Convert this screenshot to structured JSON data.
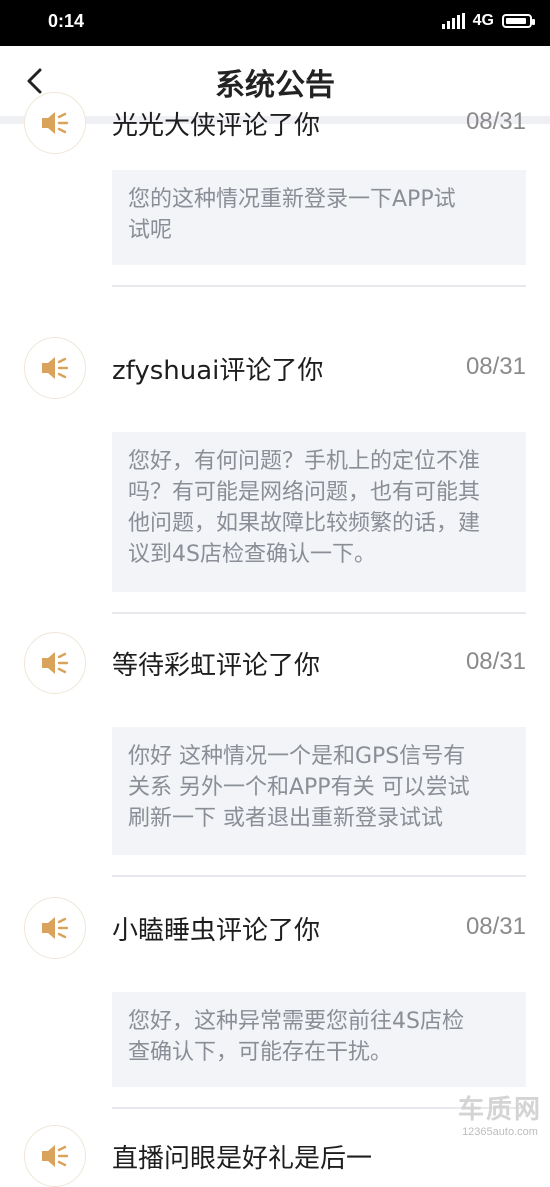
{
  "status_bar": {
    "time": "0:14",
    "network": "4G"
  },
  "header": {
    "title": "系统公告"
  },
  "notifications": [
    {
      "title": "光光大侠评论了你",
      "date": "08/31",
      "content": "您的这种情况重新登录一下APP试试呢",
      "lines": [
        "您的这种情况重新登录一下APP试",
        "试呢"
      ]
    },
    {
      "title": "zfyshuai评论了你",
      "date": "08/31",
      "content": "您好，有何问题？手机上的定位不准吗？有可能是网络问题，也有可能其他问题，如果故障比较频繁的话，建议到4S店检查确认一下。",
      "lines": [
        "您好，有何问题？手机上的定位不准",
        "吗？有可能是网络问题，也有可能其",
        "他问题，如果故障比较频繁的话，建",
        "议到4S店检查确认一下。"
      ]
    },
    {
      "title": "等待彩虹评论了你",
      "date": "08/31",
      "content": "你好 这种情况一个是和GPS信号有关系 另外一个和APP有关 可以尝试刷新一下 或者退出重新登录试试",
      "lines": [
        "你好 这种情况一个是和GPS信号有",
        "关系 另外一个和APP有关 可以尝试",
        "刷新一下 或者退出重新登录试试"
      ]
    },
    {
      "title": "小瞌睡虫评论了你",
      "date": "08/31",
      "content": "您好，这种异常需要您前往4S店检查确认下，可能存在干扰。",
      "lines": [
        "您好，这种异常需要您前往4S店检",
        "查确认下，可能存在干扰。"
      ]
    },
    {
      "title": "直播问眼是好礼是后一",
      "date": "",
      "content": "",
      "lines": []
    }
  ],
  "watermark": {
    "brand": "车质网",
    "url": "12365auto.com"
  },
  "colors": {
    "icon_gold": "#d9a35b",
    "bubble_bg": "#f2f4f7",
    "date_gray": "#8a8a8a"
  }
}
